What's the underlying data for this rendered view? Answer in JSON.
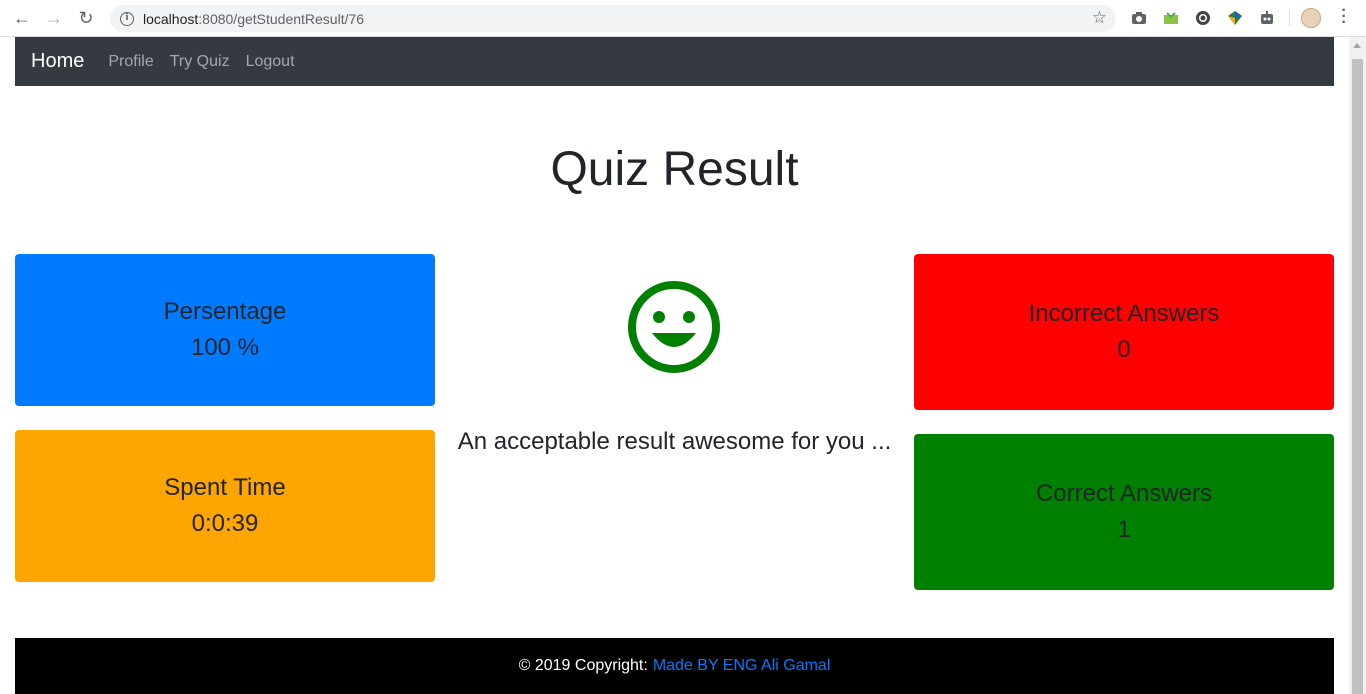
{
  "browser": {
    "url_host": "localhost",
    "url_rest": ":8080/getStudentResult/76",
    "back_icon": "←",
    "forward_icon": "→",
    "reload_icon": "↻",
    "star_icon": "☆"
  },
  "navbar": {
    "brand": "Home",
    "links": [
      "Profile",
      "Try Quiz",
      "Logout"
    ]
  },
  "page": {
    "title": "Quiz Result"
  },
  "cards": {
    "percentage": {
      "label": "Persentage",
      "value": "100 %",
      "color": "#007bff"
    },
    "spent_time": {
      "label": "Spent Time",
      "value": "0:0:39",
      "color": "#ffa500"
    },
    "incorrect": {
      "label": "Incorrect Answers",
      "value": "0",
      "color": "#ff0000"
    },
    "correct": {
      "label": "Correct Answers",
      "value": "1",
      "color": "#008000"
    }
  },
  "center": {
    "icon": "smiley-icon",
    "icon_color": "#008000",
    "message": "An acceptable result awesome for you ..."
  },
  "footer": {
    "copyright": "© 2019 Copyright:",
    "link_text": "Made BY ENG Ali Gamal"
  }
}
